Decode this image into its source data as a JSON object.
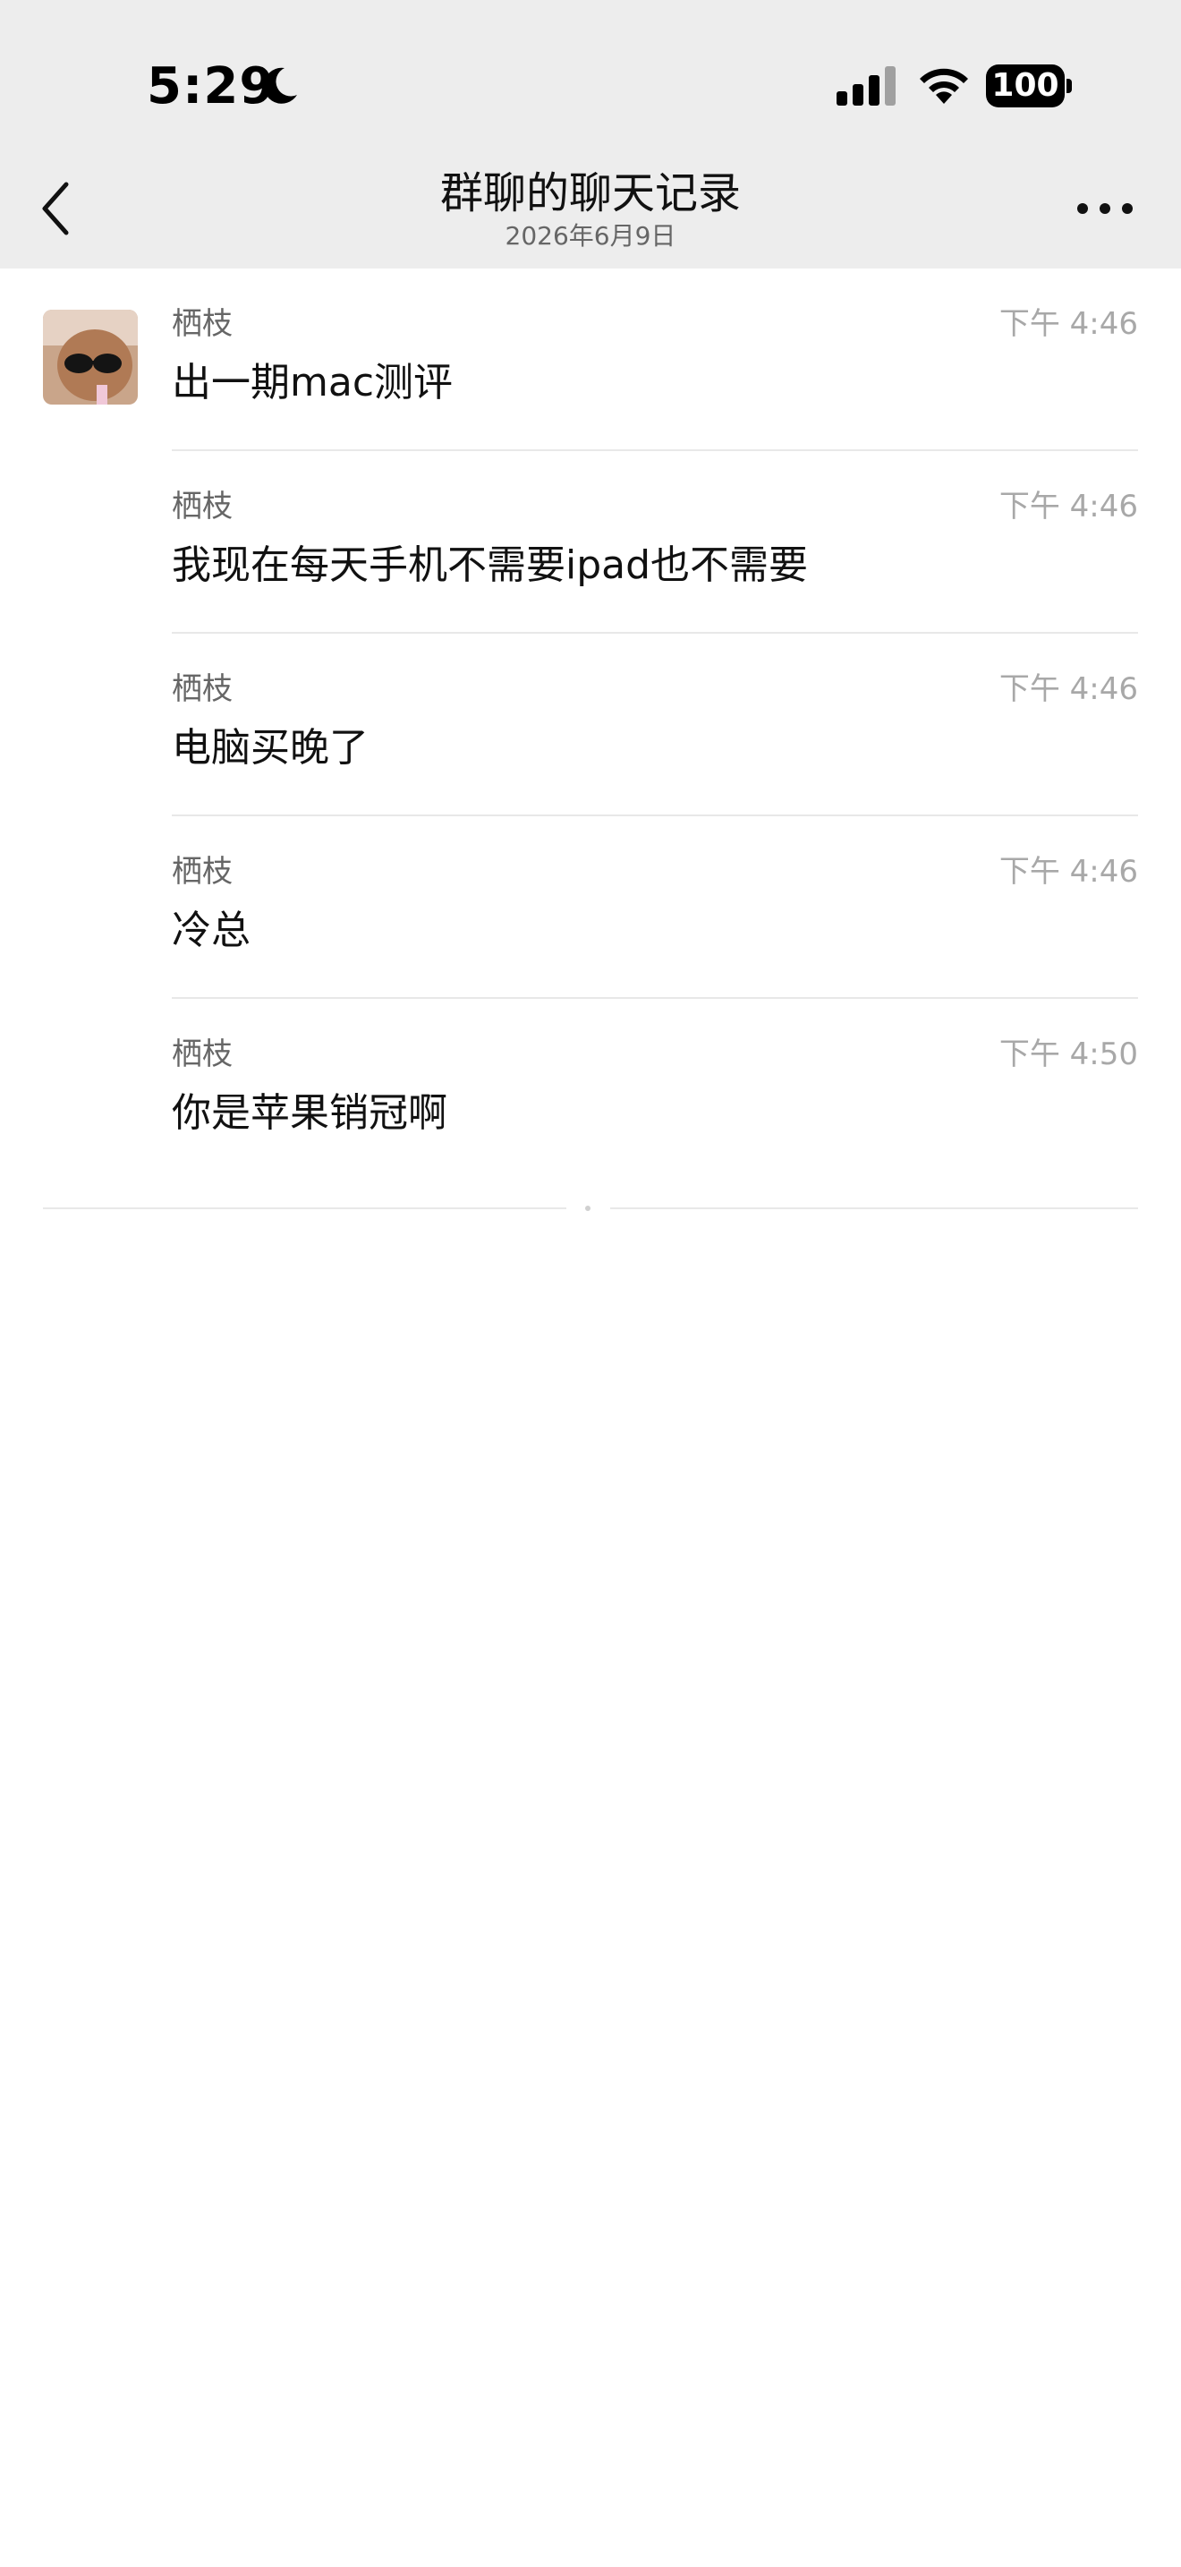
{
  "status_bar": {
    "time": "5:29",
    "moon_icon": "moon-icon",
    "signal_icon": "cellular-signal-icon",
    "wifi_icon": "wifi-icon",
    "battery_level": "100"
  },
  "header": {
    "back_icon": "chevron-left-icon",
    "title": "群聊的聊天记录",
    "subtitle": "2026年6月9日",
    "more_icon": "more-dots-icon"
  },
  "messages": [
    {
      "sender": "栖枝",
      "time": "下午 4:46",
      "text": "出一期mac测评",
      "show_avatar": true
    },
    {
      "sender": "栖枝",
      "time": "下午 4:46",
      "text": "我现在每天手机不需要ipad也不需要",
      "show_avatar": false
    },
    {
      "sender": "栖枝",
      "time": "下午 4:46",
      "text": "电脑买晚了",
      "show_avatar": false
    },
    {
      "sender": "栖枝",
      "time": "下午 4:46",
      "text": "冷总",
      "show_avatar": false
    },
    {
      "sender": "栖枝",
      "time": "下午 4:50",
      "text": "你是苹果销冠啊",
      "show_avatar": false
    }
  ],
  "colors": {
    "header_bg": "#ededed",
    "page_bg": "#ffffff",
    "time_text": "#a8a8a8",
    "sender_text": "#666666",
    "separator": "#e8e8e8"
  }
}
